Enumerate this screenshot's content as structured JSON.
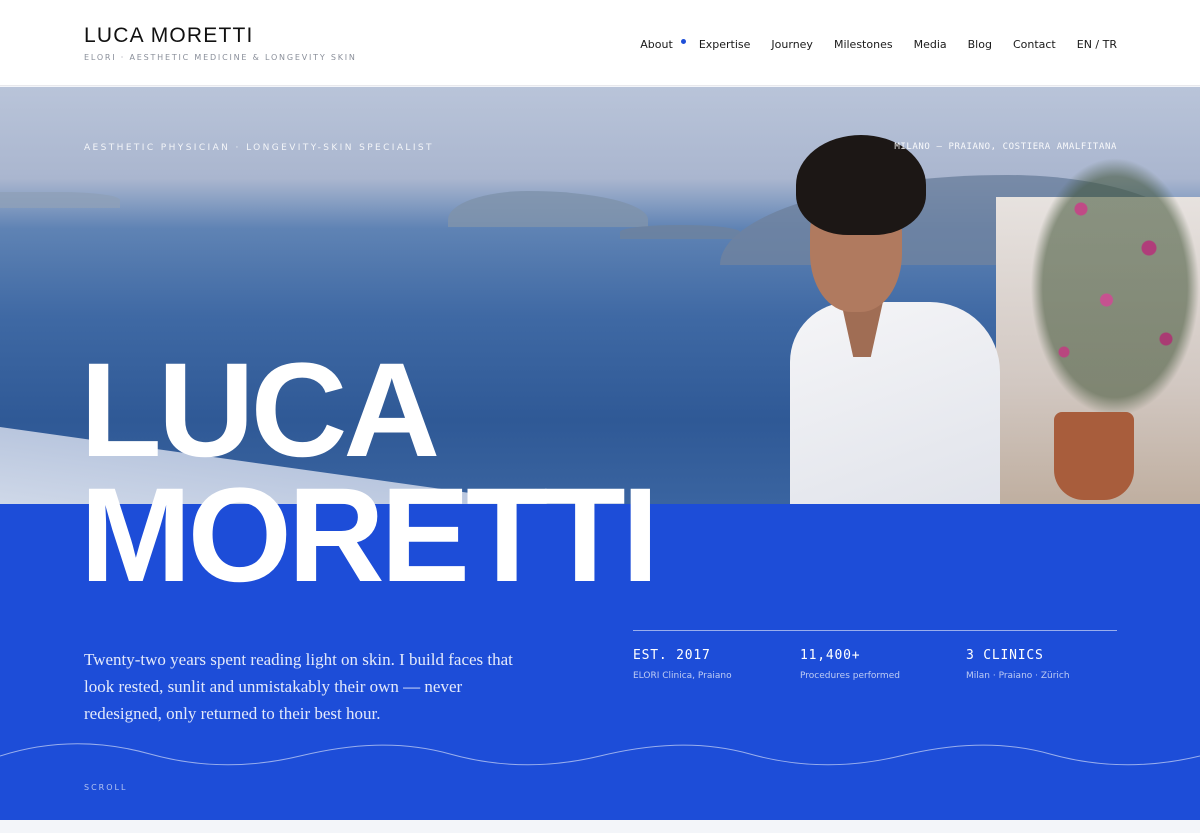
{
  "header": {
    "brand_name": "LUCA MORETTI",
    "brand_tagline": "ELORI · AESTHETIC MEDICINE & LONGEVITY SKIN",
    "nav": [
      {
        "label": "About",
        "active": true
      },
      {
        "label": "Expertise"
      },
      {
        "label": "Journey"
      },
      {
        "label": "Milestones"
      },
      {
        "label": "Media"
      },
      {
        "label": "Blog"
      },
      {
        "label": "Contact"
      },
      {
        "label": "EN / TR"
      }
    ]
  },
  "hero": {
    "label_left": "AESTHETIC PHYSICIAN · LONGEVITY-SKIN SPECIALIST",
    "label_right": "MILANO — PRAIANO, COSTIERA AMALFITANA",
    "name_line1": "LUCA",
    "name_line2": "MORETTI",
    "intro": "Twenty-two years spent reading light on skin. I build faces that look rested, sunlit and unmistakably their own — never redesigned, only returned to their best hour.",
    "stats": [
      {
        "value": "EST. 2017",
        "label": "ELORI Clinica, Praiano"
      },
      {
        "value": "11,400+",
        "label": "Procedures performed"
      },
      {
        "value": "3 CLINICS",
        "label": "Milan · Praiano · Zürich"
      }
    ],
    "scroll_label": "SCROLL"
  },
  "colors": {
    "accent_blue": "#1d4dd8",
    "nav_dot": "#1e4fd8"
  }
}
